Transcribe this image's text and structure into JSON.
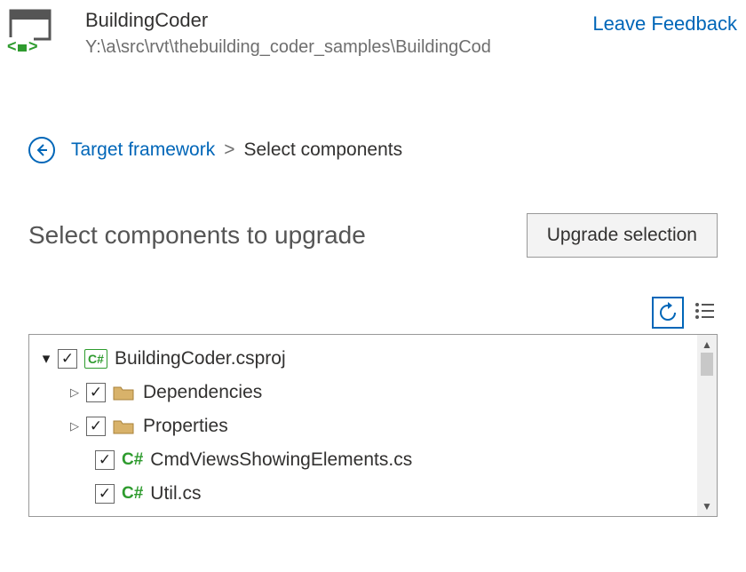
{
  "header": {
    "title": "BuildingCoder",
    "path": "Y:\\a\\src\\rvt\\thebuilding_coder_samples\\BuildingCod",
    "feedback": "Leave Feedback"
  },
  "breadcrumb": {
    "back_icon": "arrow-left",
    "link": "Target framework",
    "separator": ">",
    "current": "Select components"
  },
  "heading": "Select components to upgrade",
  "buttons": {
    "upgrade": "Upgrade selection"
  },
  "toolbar": {
    "refresh_icon": "refresh",
    "list_icon": "list-options"
  },
  "tree": {
    "root": {
      "label": "BuildingCoder.csproj",
      "badge": "C#",
      "checked": true,
      "expanded": true,
      "children": [
        {
          "label": "Dependencies",
          "type": "folder",
          "checked": true,
          "expanded": false
        },
        {
          "label": "Properties",
          "type": "folder",
          "checked": true,
          "expanded": false
        },
        {
          "label": "CmdViewsShowingElements.cs",
          "type": "cs",
          "icon": "C#",
          "checked": true
        },
        {
          "label": "Util.cs",
          "type": "cs",
          "icon": "C#",
          "checked": true
        }
      ]
    }
  }
}
